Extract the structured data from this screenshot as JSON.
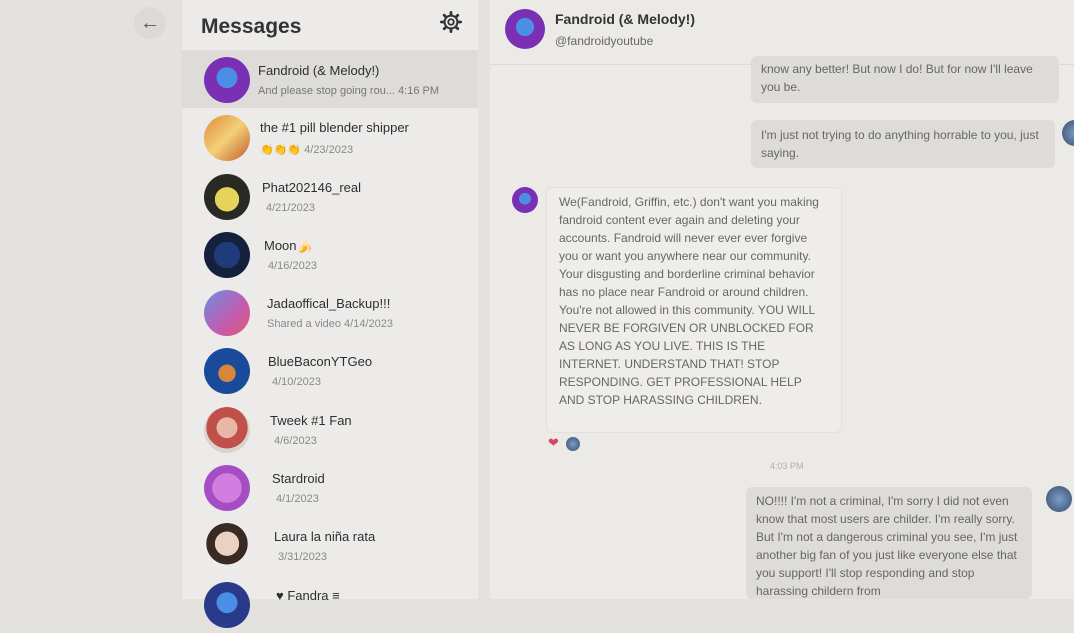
{
  "nav": {
    "back_icon": "←"
  },
  "messages_panel": {
    "title": "Messages",
    "conversations": [
      {
        "name": "Fandroid (& Melody!)",
        "sub": "And please stop going rou... 4:16 PM",
        "active": true
      },
      {
        "name": "the #1 pill blender shipper",
        "sub": "👏👏👏 4/23/2023"
      },
      {
        "name": "Phat202146_real",
        "sub": "4/21/2023"
      },
      {
        "name": "Moon🍌",
        "sub": "4/16/2023"
      },
      {
        "name": "Jadaoffical_Backup!!!",
        "sub": "Shared a video 4/14/2023"
      },
      {
        "name": "BlueBaconYTGeo",
        "sub": "4/10/2023"
      },
      {
        "name": "Tweek #1 Fan",
        "sub": "4/6/2023"
      },
      {
        "name": "Stardroid",
        "sub": "4/1/2023"
      },
      {
        "name": "Laura la niña rata",
        "sub": "3/31/2023"
      },
      {
        "name": "♥ Fandra ≡",
        "sub": ""
      }
    ]
  },
  "chat": {
    "name": "Fandroid (& Melody!)",
    "handle": "@fandroidyoutube",
    "messages": [
      {
        "dir": "out",
        "text": "know any better! But now I do! But for now I'll leave you be."
      },
      {
        "dir": "out",
        "text": "I'm just not trying to do anything horrable to you, just saying."
      },
      {
        "dir": "in",
        "text": "We(Fandroid, Griffin, etc.) don't want you making fandroid content ever again and deleting your accounts. Fandroid will never ever ever forgive you or want you anywhere near our community. Your disgusting and borderline criminal behavior has no place near Fandroid or around children. You're not allowed in this community. YOU WILL NEVER BE FORGIVEN OR UNBLOCKED FOR AS LONG AS YOU LIVE. THIS IS THE INTERNET. UNDERSTAND THAT! STOP RESPONDING. GET PROFESSIONAL HELP AND STOP HARASSING CHILDREN."
      },
      {
        "dir": "out",
        "text": "NO!!!! I'm not a criminal, I'm sorry I did not even know that most users are childer. I'm really sorry. But I'm not a dangerous criminal you see, I'm just another big fan of you just like everyone else that you support! I'll stop responding and stop harassing childern from"
      }
    ],
    "timestamp": "4:03 PM",
    "reaction": "❤"
  }
}
